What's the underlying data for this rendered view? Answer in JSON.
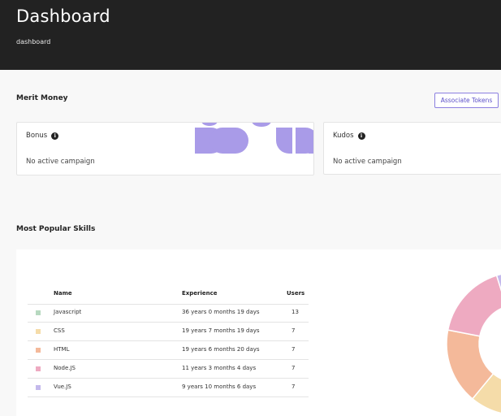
{
  "header": {
    "title": "Dashboard",
    "subtitle": "dashboard"
  },
  "merit": {
    "title": "Merit Money",
    "associate_label": "Associate Tokens",
    "bonus": {
      "label": "Bonus",
      "status": "No active campaign"
    },
    "kudos": {
      "label": "Kudos",
      "status": "No active campaign"
    },
    "deco_color": "#a99be8"
  },
  "skills": {
    "title": "Most Popular Skills",
    "columns": {
      "name": "Name",
      "experience": "Experience",
      "users": "Users"
    },
    "rows": [
      {
        "name": "Javascript",
        "experience": "36 years 0 months 19 days",
        "users": "13",
        "color": "#b7d9c0"
      },
      {
        "name": "CSS",
        "experience": "19 years 7 months 19 days",
        "users": "7",
        "color": "#f5dca9"
      },
      {
        "name": "HTML",
        "experience": "19 years 6 months 20 days",
        "users": "7",
        "color": "#f4b99a"
      },
      {
        "name": "Node.JS",
        "experience": "11 years 3 months 4 days",
        "users": "7",
        "color": "#eeaac1"
      },
      {
        "name": "Vue.JS",
        "experience": "9 years 10 months 6 days",
        "users": "7",
        "color": "#c4b9ec"
      }
    ]
  },
  "chart_data": {
    "type": "pie",
    "categories": [
      "Javascript",
      "CSS",
      "HTML",
      "Node.JS",
      "Vue.JS"
    ],
    "values": [
      13,
      7,
      7,
      7,
      7
    ],
    "colors": [
      "#b7d9c0",
      "#f5dca9",
      "#f4b99a",
      "#eeaac1",
      "#c4b9ec"
    ]
  }
}
